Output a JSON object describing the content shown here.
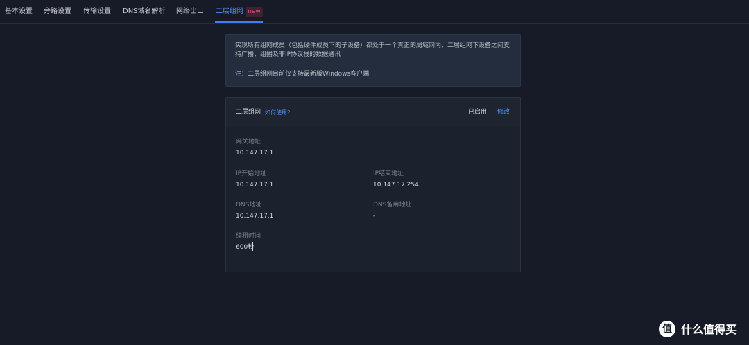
{
  "tabs": [
    {
      "label": "基本设置"
    },
    {
      "label": "旁路设置"
    },
    {
      "label": "传输设置"
    },
    {
      "label": "DNS域名解析"
    },
    {
      "label": "网络出口"
    },
    {
      "label": "二层组网",
      "badge": "new",
      "active": true
    }
  ],
  "notice": {
    "text": "实现所有组网成员（包括硬件成员下的子设备）都处于一个真正的局域网内，二层组网下设备之间支持广播，组播及非IP协议栈的数据通讯",
    "note": "注：二层组网目前仅支持最新版Windows客户端"
  },
  "card": {
    "title": "二层组网",
    "help_link": "如何使用?",
    "status": "已启用",
    "edit_label": "修改",
    "fields": {
      "gateway": {
        "label": "网关地址",
        "value": "10.147.17.1"
      },
      "ip_start": {
        "label": "IP开始地址",
        "value": "10.147.17.1"
      },
      "ip_end": {
        "label": "IP结束地址",
        "value": "10.147.17.254"
      },
      "dns": {
        "label": "DNS地址",
        "value": "10.147.17.1"
      },
      "dns_backup": {
        "label": "DNS备用地址",
        "value": "-"
      },
      "lease": {
        "label": "续租时间",
        "value": "600秒"
      }
    }
  },
  "watermark": {
    "glyph": "值",
    "text": "什么值得买"
  }
}
